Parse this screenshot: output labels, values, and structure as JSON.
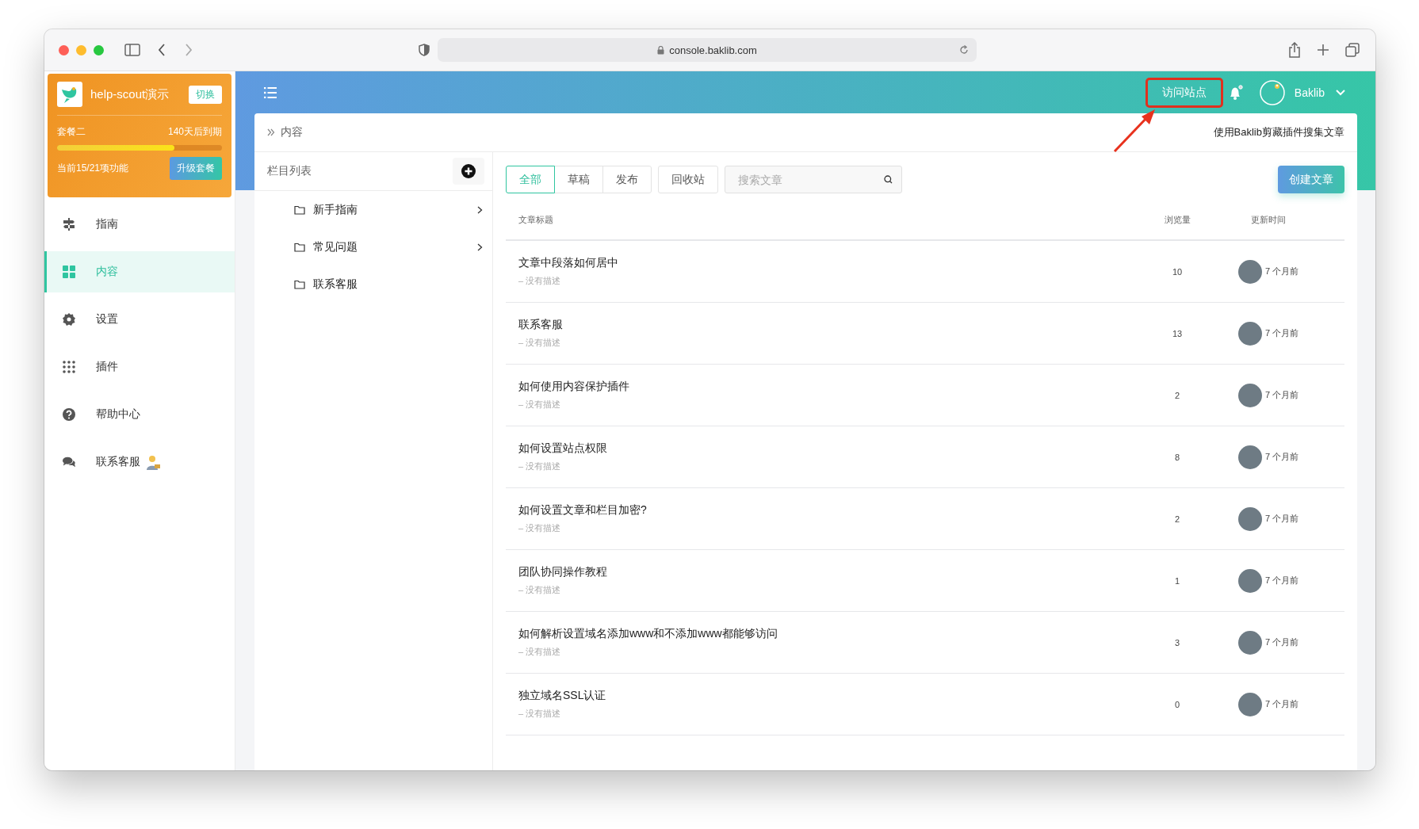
{
  "browser": {
    "url": "console.baklib.com"
  },
  "plan_card": {
    "site_name": "help-scout演示",
    "switch_label": "切换",
    "plan": "套餐二",
    "expiry": "140天后到期",
    "level": 0.71,
    "usage": "当前15/21项功能",
    "upgrade_label": "升级套餐"
  },
  "sidebar": {
    "items": [
      {
        "label": "指南",
        "kind": "guide",
        "selected": false,
        "badge_icon": false
      },
      {
        "label": "内容",
        "kind": "content",
        "selected": true,
        "badge_icon": false
      },
      {
        "label": "设置",
        "kind": "settings",
        "selected": false,
        "badge_icon": false
      },
      {
        "label": "插件",
        "kind": "plugins",
        "selected": false,
        "badge_icon": false
      },
      {
        "label": "帮助中心",
        "kind": "help",
        "selected": false,
        "badge_icon": false
      },
      {
        "label": "联系客服",
        "kind": "chat",
        "selected": false,
        "badge_icon": true
      }
    ]
  },
  "top_bar": {
    "visit_site": {
      "label": "访问站点",
      "highlighted": true
    },
    "notifications_dot": true,
    "user_name": "Baklib"
  },
  "breadcrumb": "内容",
  "clipper_hint": "使用Baklib剪藏插件搜集文章",
  "category_list": {
    "title": "栏目列表",
    "items": [
      {
        "label": "新手指南",
        "has_children": true
      },
      {
        "label": "常见问题",
        "has_children": true
      },
      {
        "label": "联系客服",
        "has_children": false
      }
    ]
  },
  "filter_tabs": [
    {
      "label": "全部",
      "selected": true
    },
    {
      "label": "草稿",
      "selected": false
    },
    {
      "label": "发布",
      "selected": false
    }
  ],
  "trash_button": "回收站",
  "search": {
    "placeholder": "搜索文章"
  },
  "create_button": "创建文章",
  "table": {
    "columns": [
      "文章标题",
      "浏览量",
      "更新时间"
    ],
    "rows": [
      {
        "title": "文章中段落如何居中",
        "description": "– 没有描述",
        "views": "10",
        "updated": "7 个月前"
      },
      {
        "title": "联系客服",
        "description": "– 没有描述",
        "views": "13",
        "updated": "7 个月前"
      },
      {
        "title": "如何使用内容保护插件",
        "description": "– 没有描述",
        "views": "2",
        "updated": "7 个月前"
      },
      {
        "title": "如何设置站点权限",
        "description": "– 没有描述",
        "views": "8",
        "updated": "7 个月前"
      },
      {
        "title": "如何设置文章和栏目加密?",
        "description": "– 没有描述",
        "views": "2",
        "updated": "7 个月前"
      },
      {
        "title": "团队协同操作教程",
        "description": "– 没有描述",
        "views": "1",
        "updated": "7 个月前"
      },
      {
        "title": "如何解析设置域名添加www和不添加www都能够访问",
        "description": "– 没有描述",
        "views": "3",
        "updated": "7 个月前"
      },
      {
        "title": "独立域名SSL认证",
        "description": "– 没有描述",
        "views": "0",
        "updated": "7 个月前"
      }
    ]
  }
}
